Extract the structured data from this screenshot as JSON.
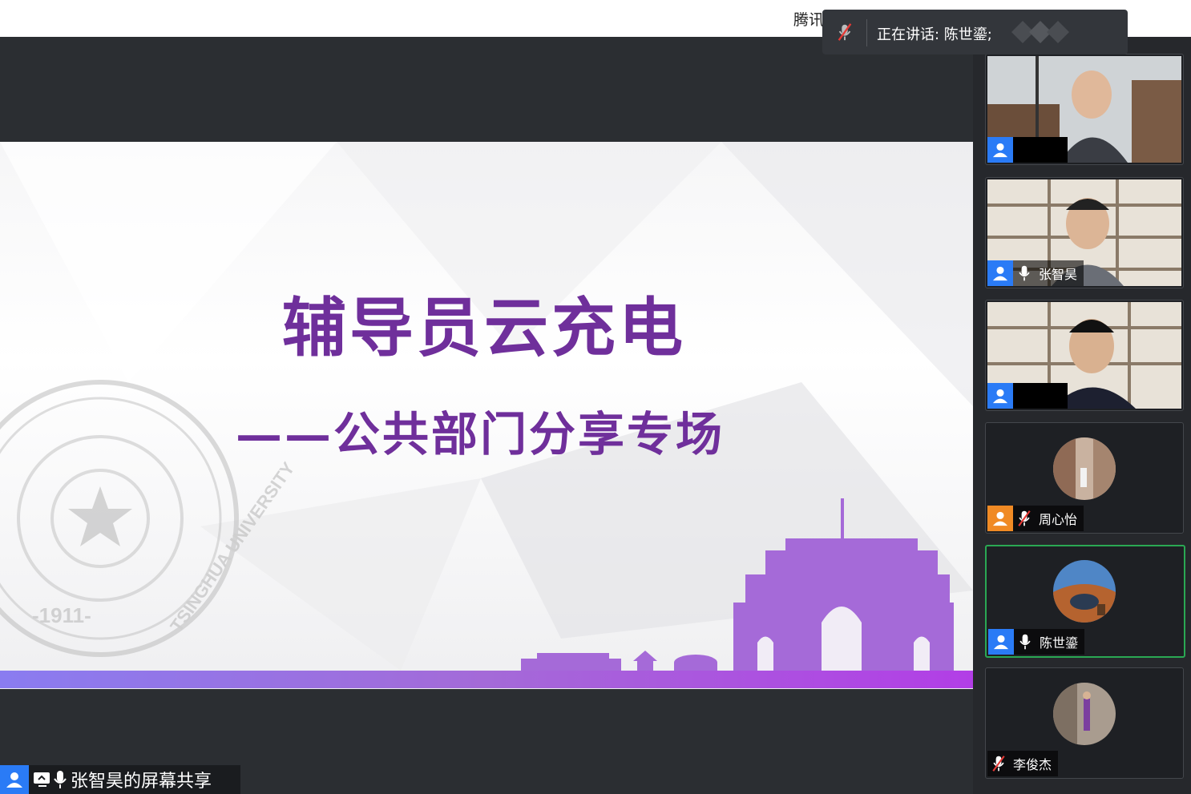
{
  "titlebar": {
    "app_title": "腾讯"
  },
  "speaking": {
    "text": "正在讲话: 陈世鎏;"
  },
  "slide": {
    "title": "辅导员云充电",
    "subtitle": "——公共部门分享专场",
    "seal_text": "TSINGHUA UNIVERSITY",
    "seal_year": "-1911-",
    "accent_color": "#6f2f9b"
  },
  "share": {
    "label": "张智昊的屏幕共享"
  },
  "participants": [
    {
      "name": "",
      "mic": "none",
      "badge": "blue",
      "type": "video"
    },
    {
      "name": "张智昊",
      "mic": "on",
      "badge": "blue",
      "type": "video"
    },
    {
      "name": "",
      "mic": "none",
      "badge": "blue",
      "type": "video"
    },
    {
      "name": "周心怡",
      "mic": "muted",
      "badge": "orange",
      "type": "avatar"
    },
    {
      "name": "陈世鎏",
      "mic": "on",
      "badge": "blue",
      "type": "avatar"
    },
    {
      "name": "李俊杰",
      "mic": "muted",
      "badge": "none",
      "type": "avatar"
    }
  ],
  "colors": {
    "active_speaker_border": "#2aa853",
    "user_badge": "#2a7bf6"
  }
}
